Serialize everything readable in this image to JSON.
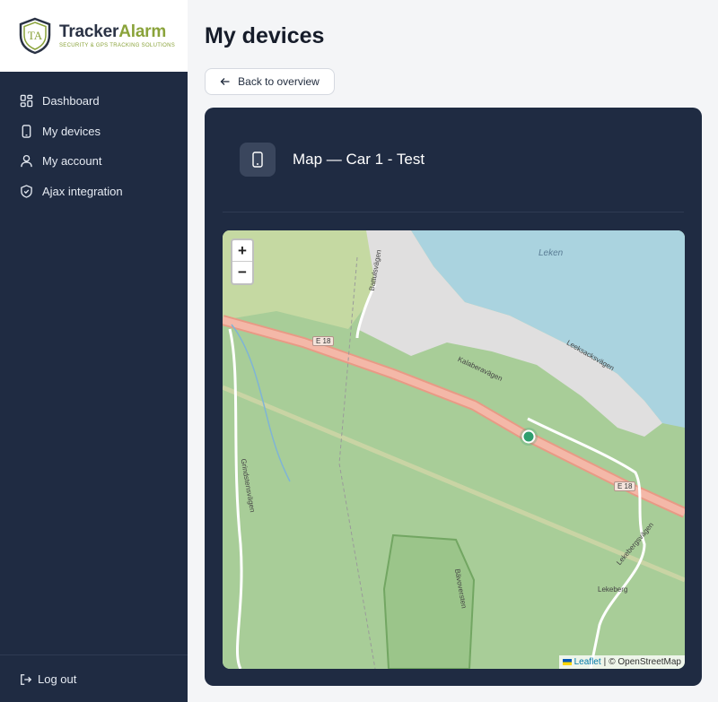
{
  "brand": {
    "name_part1": "Tracker",
    "name_part2": "Alarm",
    "tagline": "SECURITY & GPS TRACKING SOLUTIONS",
    "shield_letters": "TA",
    "primary_color": "#1f2b42",
    "accent_color": "#8aa33a"
  },
  "sidebar": {
    "items": [
      {
        "label": "Dashboard",
        "icon": "dashboard-icon"
      },
      {
        "label": "My devices",
        "icon": "phone-icon"
      },
      {
        "label": "My account",
        "icon": "user-icon"
      },
      {
        "label": "Ajax integration",
        "icon": "shield-check-icon"
      }
    ],
    "logout_label": "Log out"
  },
  "main": {
    "title": "My devices",
    "back_label": "Back to overview",
    "card_title": "Map — Car 1 - Test"
  },
  "map": {
    "zoom_in": "+",
    "zoom_out": "−",
    "attribution_link": "Leaflet",
    "attribution_sep": "|",
    "attribution_text": "© OpenStreetMap",
    "labels": {
      "lake": "Leken",
      "road_e18_a": "E 18",
      "road_e18_b": "E 18",
      "street1": "Battulsvägen",
      "street2": "Kalaberavägen",
      "street3": "Leeksacksvägen",
      "street4": "Lekebergsvägen",
      "street5": "Grindstensvägen",
      "place": "Lekeberg",
      "trail": "Bävoversten"
    },
    "marker_color": "#2f9e6e"
  }
}
